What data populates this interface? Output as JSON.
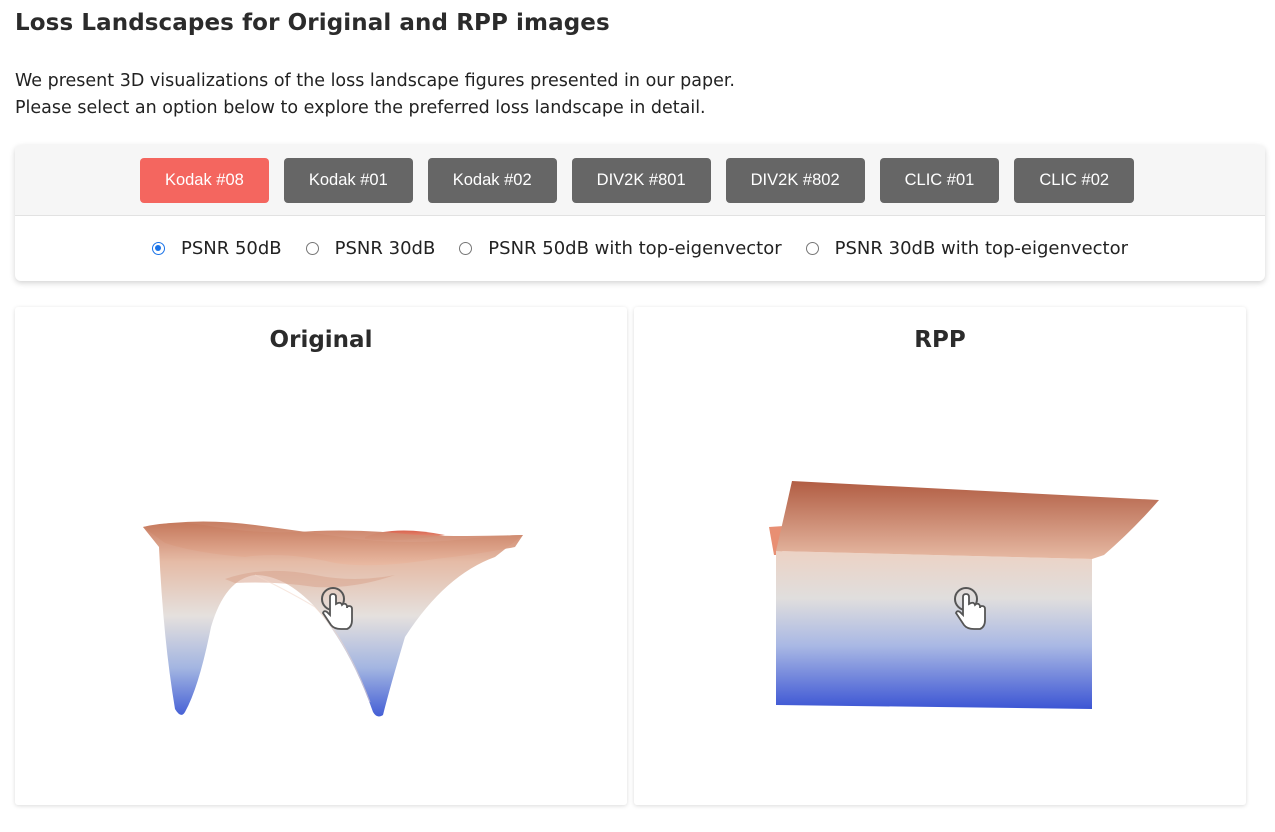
{
  "page": {
    "title": "Loss Landscapes for Original and RPP images",
    "intro_line_1": "We present 3D visualizations of the loss landscape figures presented in our paper.",
    "intro_line_2": "Please select an option below to explore the preferred loss landscape in detail."
  },
  "image_tabs": [
    {
      "label": "Kodak #08",
      "active": true
    },
    {
      "label": "Kodak #01",
      "active": false
    },
    {
      "label": "Kodak #02",
      "active": false
    },
    {
      "label": "DIV2K #801",
      "active": false
    },
    {
      "label": "DIV2K #802",
      "active": false
    },
    {
      "label": "CLIC #01",
      "active": false
    },
    {
      "label": "CLIC #02",
      "active": false
    }
  ],
  "options": [
    {
      "label": "PSNR 50dB",
      "checked": true
    },
    {
      "label": "PSNR 30dB",
      "checked": false
    },
    {
      "label": "PSNR 50dB with top-eigenvector",
      "checked": false
    },
    {
      "label": "PSNR 30dB with top-eigenvector",
      "checked": false
    }
  ],
  "cards": {
    "original": {
      "title": "Original",
      "icon": "pointer-hand-icon"
    },
    "rpp": {
      "title": "RPP",
      "icon": "pointer-hand-icon"
    }
  },
  "colors": {
    "active_tab": "#f4665f",
    "inactive_tab": "#666666",
    "surface_high": "#b85a3e",
    "surface_mid": "#e6e0dc",
    "surface_low": "#3f56d0",
    "radio_checked": "#1a73e8"
  }
}
